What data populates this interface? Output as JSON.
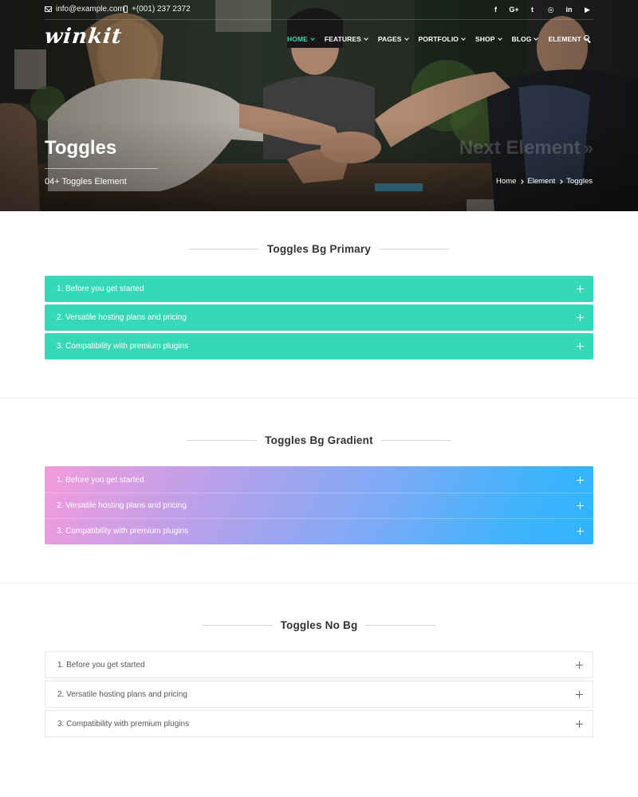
{
  "topbar": {
    "email": "info@example.com",
    "phone": "+(001) 237 2372",
    "socials": [
      {
        "icon": "facebook-icon",
        "glyph": "f"
      },
      {
        "icon": "google-plus-icon",
        "glyph": "G+"
      },
      {
        "icon": "twitter-icon",
        "glyph": "t"
      },
      {
        "icon": "instagram-icon",
        "glyph": "◎"
      },
      {
        "icon": "linkedin-icon",
        "glyph": "in"
      },
      {
        "icon": "youtube-icon",
        "glyph": "▶"
      }
    ]
  },
  "brand": {
    "logo": "winkit"
  },
  "nav": {
    "items": [
      {
        "label": "HOME",
        "active": true
      },
      {
        "label": "FEATURES",
        "active": false
      },
      {
        "label": "PAGES",
        "active": false
      },
      {
        "label": "PORTFOLIO",
        "active": false
      },
      {
        "label": "SHOP",
        "active": false
      },
      {
        "label": "BLOG",
        "active": false
      },
      {
        "label": "ELEMENT",
        "active": false
      }
    ]
  },
  "hero": {
    "title": "Toggles",
    "subtitle": "04+ Toggles Element",
    "next_label": "Next Element",
    "next_arrow": "»",
    "breadcrumb": [
      "Home",
      "Element",
      "Toggles"
    ]
  },
  "sections": [
    {
      "heading": "Toggles Bg Primary",
      "items": [
        "1. Before you get started",
        "2. Versatile hosting plans and pricing",
        "3. Compatibility with premium plugins"
      ]
    },
    {
      "heading": "Toggles Bg Gradient",
      "items": [
        "1. Before you get started",
        "2. Versatile hosting plans and pricing",
        "3. Compatibility with premium plugins"
      ]
    },
    {
      "heading": "Toggles No Bg",
      "items": [
        "1. Before you get started",
        "2. Versatile hosting plans and pricing",
        "3. Compatibility with premium plugins"
      ]
    }
  ],
  "colors": {
    "accent": "#36d8b7",
    "nav_active": "#3ad9b5",
    "gradient_start": "#f49bdc",
    "gradient_end": "#2fb4fd"
  }
}
